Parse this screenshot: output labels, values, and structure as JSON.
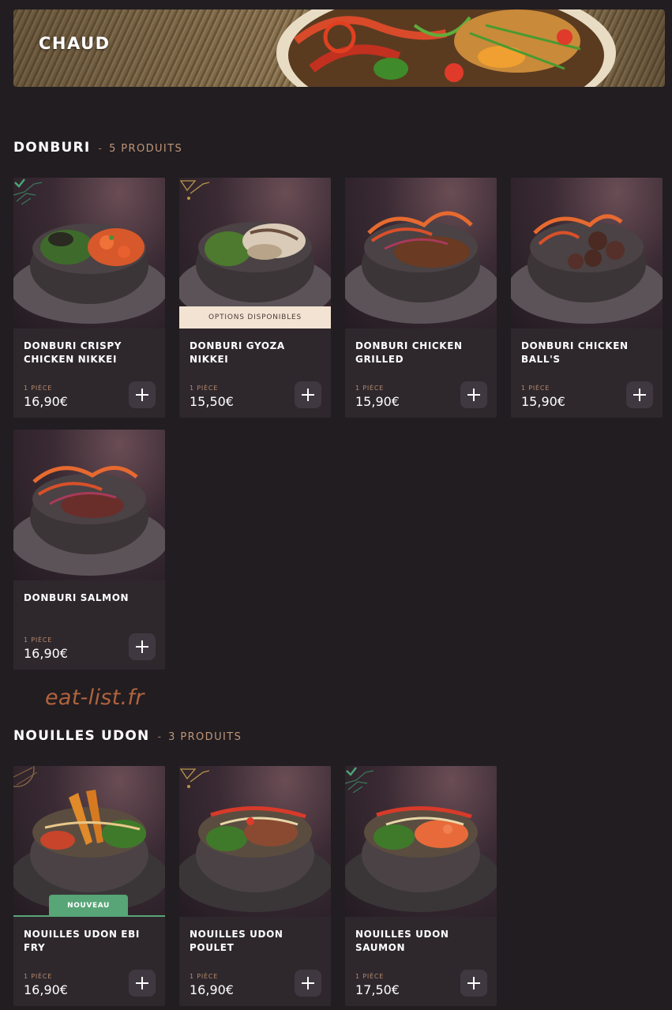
{
  "banner": {
    "title": "CHAUD"
  },
  "sections": [
    {
      "title": "DONBURI",
      "separator": "-",
      "count": "5 PRODUITS",
      "products": [
        {
          "name": "DONBURI CRISPY CHICKEN NIKKEI",
          "unit": "1 PIÈCE",
          "price": "16,90€",
          "corner": "green-check"
        },
        {
          "name": "DONBURI GYOZA NIKKEI",
          "unit": "1 PIÈCE",
          "price": "15,50€",
          "corner": "gold",
          "ribbon": "OPTIONS DISPONIBLES"
        },
        {
          "name": "DONBURI CHICKEN GRILLED",
          "unit": "1 PIÈCE",
          "price": "15,90€"
        },
        {
          "name": "DONBURI CHICKEN BALL'S",
          "unit": "1 PIÈCE",
          "price": "15,90€"
        },
        {
          "name": "DONBURI SALMON",
          "unit": "1 PIÈCE",
          "price": "16,90€"
        }
      ]
    },
    {
      "title": "NOUILLES UDON",
      "separator": "-",
      "count": "3 PRODUITS",
      "products": [
        {
          "name": "NOUILLES UDON EBI FRY",
          "unit": "1 PIÈCE",
          "price": "16,90€",
          "corner": "bronze",
          "badge": "NOUVEAU"
        },
        {
          "name": "NOUILLES UDON POULET",
          "unit": "1 PIÈCE",
          "price": "16,90€",
          "corner": "gold"
        },
        {
          "name": "NOUILLES UDON SAUMON",
          "unit": "1 PIÈCE",
          "price": "17,50€",
          "corner": "green-check"
        }
      ]
    }
  ],
  "watermark": "eat-list.fr",
  "icons": {
    "add": "plus-icon"
  },
  "colors": {
    "background": "#211d21",
    "card": "#2e282d",
    "accent_text": "#c09678",
    "new_badge": "#58a577",
    "options_ribbon": "#f3e3d3"
  }
}
